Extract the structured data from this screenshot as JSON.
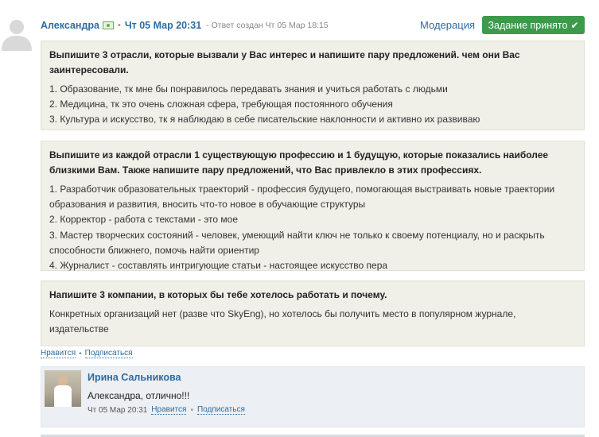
{
  "post": {
    "author": "Александра",
    "date": "Чт 05 Мар 20:31",
    "created_sep": "-",
    "created": "Ответ создан Чт 05 Мар 18:15",
    "moderation_label": "Модерация",
    "status_label": "Задание принято"
  },
  "blocks": [
    {
      "question": "Выпишите 3 отрасли, которые вызвали у Вас интерес и напишите пару предложений. чем они Вас заинтересовали.",
      "answers": [
        "1. Образование, тк мне бы понравилось передавать знания и учиться работать с людьми",
        "2. Медицина, тк это очень сложная сфера, требующая постоянного обучения",
        "3. Культура и искусство, тк я наблюдаю в себе писательские наклонности и активно их развиваю"
      ]
    },
    {
      "question": "Выпишите из каждой отрасли 1 существующую профессию и 1 будущую, которые показались наиболее близкими Вам. Также напишите пару предложений, что Вас привлекло в этих профессиях.",
      "answers": [
        "1. Разработчик образовательных траекторий - профессия будущего, помогающая выстраивать новые траектории образования и развития, вносить что-то новое в обучающие структуры",
        "2. Корректор - работа с текстами - это мое",
        "3. Мастер творческих состояний - человек, умеющий найти ключ не только к своему потенциалу, но и раскрыть способности ближнего, помочь найти ориентир",
        "4. Журналист - составлять интригующие статьи - настоящее искусство пера"
      ]
    },
    {
      "question": "Напишите 3 компании, в которых бы тебе хотелось работать и почему.",
      "answers": [
        "Конкретных организаций нет (разве что SkyEng), но хотелось бы получить место в популярном журнале, издательстве"
      ]
    }
  ],
  "post_actions": {
    "like": "Нравится",
    "dot": "•",
    "subscribe": "Подписаться"
  },
  "comment": {
    "author": "Ирина Сальникова",
    "text": "Александра, отлично!!!",
    "date": "Чт 05 Мар 20:31",
    "like": "Нравится",
    "dot": "•",
    "subscribe": "Подписаться"
  },
  "colors": {
    "link": "#2d6ca2",
    "accepted": "#3c9b4a",
    "block_bg": "#f0efe8",
    "comment_bg": "#eceff3"
  },
  "icons": {
    "avatar": "default-user-icon",
    "money": "money-icon",
    "check": "check-icon"
  }
}
